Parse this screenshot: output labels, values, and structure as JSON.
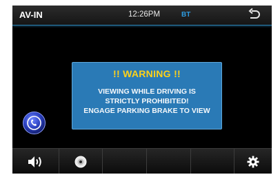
{
  "header": {
    "source_label": "AV-IN",
    "time": "12:26PM",
    "bt_label": "BT",
    "back_icon": "back-arrow-icon"
  },
  "warning": {
    "title": "!! WARNING !!",
    "lines": [
      "VIEWING WHILE DRIVING IS",
      "STRICTLY PROHIBITED!",
      "ENGAGE PARKING BRAKE TO VIEW"
    ]
  },
  "side_buttons": {
    "phone_icon": "phone-icon"
  },
  "bottom_bar": {
    "items": [
      {
        "icon": "volume-icon"
      },
      {
        "icon": "disc-icon"
      },
      {
        "icon": "empty-slot"
      },
      {
        "icon": "empty-slot"
      },
      {
        "icon": "empty-slot"
      },
      {
        "icon": "settings-gear-icon"
      }
    ]
  },
  "colors": {
    "accent_blue": "#2a7ab6",
    "warning_yellow": "#ffd21a",
    "bt_blue": "#2d9be0"
  }
}
